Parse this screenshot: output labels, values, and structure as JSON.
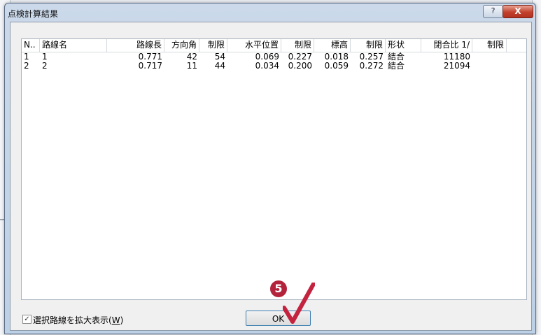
{
  "dialog": {
    "title": "点検計算結果",
    "help_label": "?",
    "close_label": "X"
  },
  "list": {
    "columns": [
      "N..",
      "路線名",
      "路線長",
      "方向角",
      "制限",
      "水平位置",
      "制限",
      "標高",
      "制限",
      "形状",
      "閉合比 1/",
      "制限"
    ],
    "rows": [
      [
        "1",
        "1",
        "0.771",
        "42",
        "54",
        "0.069",
        "0.227",
        "0.018",
        "0.257",
        "結合",
        "11180",
        ""
      ],
      [
        "2",
        "2",
        "0.717",
        "11",
        "44",
        "0.034",
        "0.200",
        "0.059",
        "0.272",
        "結合",
        "21094",
        ""
      ]
    ]
  },
  "options": {
    "zoom_checkbox_checked": true,
    "zoom_checkbox_label": "選択路線を拡大表示(",
    "zoom_checkbox_hotkey": "W",
    "zoom_checkbox_suffix": ")"
  },
  "footer": {
    "ok_label": "OK"
  },
  "annotation": {
    "step_number": "5",
    "badge_color": "#b3233b"
  }
}
